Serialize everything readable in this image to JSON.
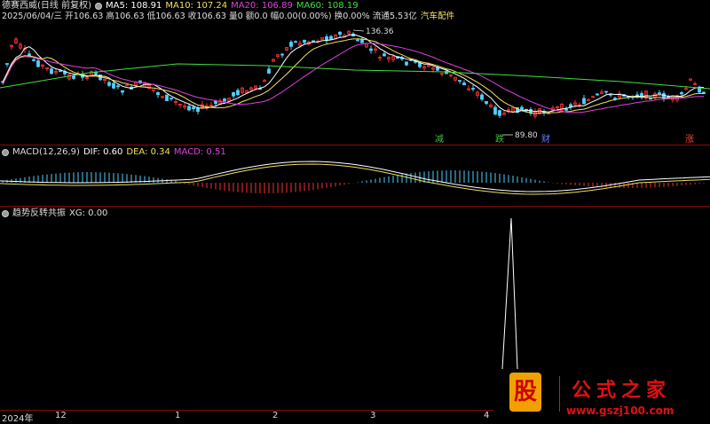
{
  "header": {
    "title": "德赛西威(日线 前复权)",
    "ma": [
      {
        "label": "MA5: 108.91",
        "color": "#ffffff"
      },
      {
        "label": "MA10: 107.24",
        "color": "#f0e060"
      },
      {
        "label": "MA20: 106.89",
        "color": "#e040e0"
      },
      {
        "label": "MA60: 108.19",
        "color": "#40e040"
      }
    ],
    "quote": "2025/06/04/三  开106.63 高106.63 低106.63 收106.63 量0 额0.0 幅0.00(0.00%) 换0.00% 流通5.53亿",
    "industry": "汽车配件"
  },
  "price_chart": {
    "high_label": "136.36",
    "low_label": "89.80",
    "markers": [
      {
        "text": "减",
        "color": "#40c040"
      },
      {
        "text": "跌",
        "color": "#40c040"
      },
      {
        "text": "财",
        "color": "#6080ff"
      },
      {
        "text": "涨",
        "color": "#ff4040"
      }
    ],
    "colors": {
      "up": "#ff3030",
      "down": "#50d0ff",
      "ma5": "#ffffff",
      "ma10": "#f0e060",
      "ma20": "#e040e0",
      "ma60": "#40e040"
    }
  },
  "macd": {
    "title": "MACD(12,26,9)",
    "dif": "DIF: 0.60",
    "dea": "DEA: 0.34",
    "macd": "MACD: 0.51"
  },
  "xg": {
    "title": "趋势反转共振",
    "value": "XG: 0.00"
  },
  "x_axis": {
    "labels": [
      "2024年",
      "12",
      "1",
      "2",
      "3",
      "4"
    ]
  },
  "watermark": {
    "badge": "股",
    "title": "公式之家",
    "url": "www.gszj100.com"
  }
}
